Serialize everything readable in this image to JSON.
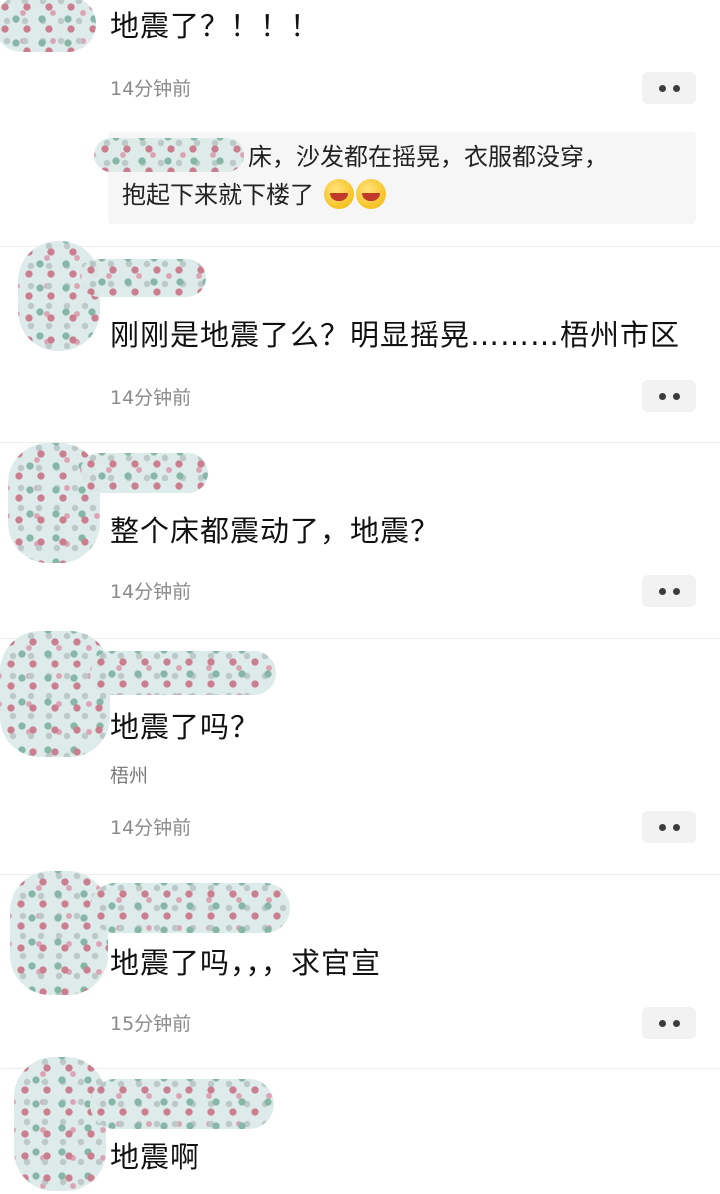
{
  "posts": [
    {
      "text": "地震了？！！！",
      "time": "14分钟前",
      "reply": {
        "line1": "床，沙发都在摇晃，衣服都没穿，",
        "line2": "抱起下来就下楼了",
        "emoji": [
          "face-with-hand-emoji",
          "face-with-hand-emoji"
        ]
      }
    },
    {
      "text": "刚刚是地震了么？明显摇晃………梧州市区",
      "time": "14分钟前"
    },
    {
      "text": "整个床都震动了，地震？",
      "time": "14分钟前"
    },
    {
      "text": "地震了吗？",
      "location": "梧州",
      "time": "14分钟前"
    },
    {
      "text": "地震了吗，，，求官宣",
      "time": "15分钟前"
    },
    {
      "text": "地震啊"
    }
  ],
  "icons": {
    "more": "more-dots-icon",
    "avatar": "blurred-avatar"
  },
  "colors": {
    "more_button_bg": "#f2f2f2",
    "reply_bg": "#f6f6f6",
    "meta_text": "#8a8a8a"
  }
}
